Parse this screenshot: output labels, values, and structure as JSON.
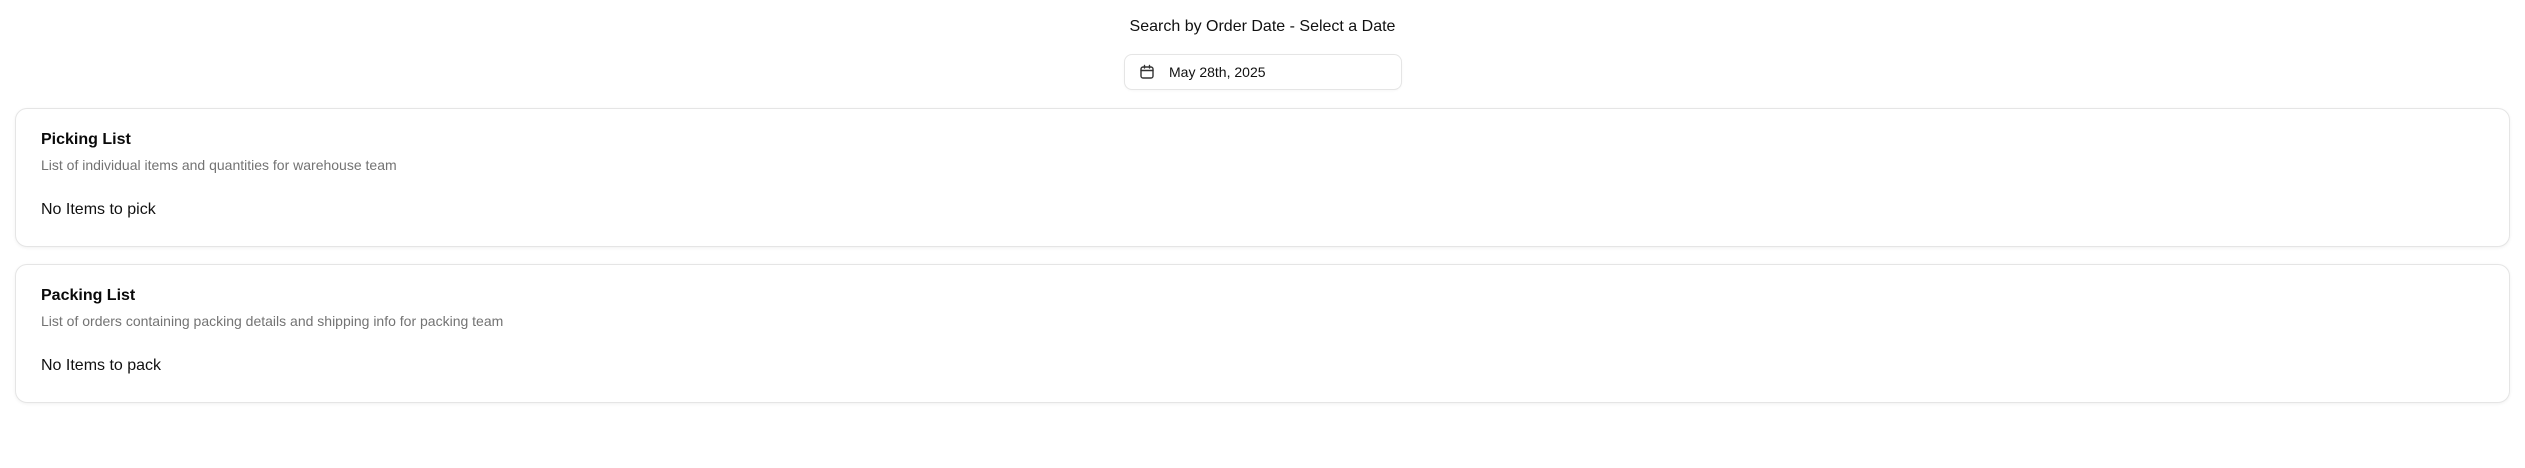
{
  "search": {
    "title": "Search by Order Date - Select a Date",
    "date_value": "May 28th, 2025",
    "icon": "calendar-icon"
  },
  "picking": {
    "title": "Picking List",
    "description": "List of individual items and quantities for warehouse team",
    "empty_text": "No Items to pick"
  },
  "packing": {
    "title": "Packing List",
    "description": "List of orders containing packing details and shipping info for packing team",
    "empty_text": "No Items to pack"
  }
}
